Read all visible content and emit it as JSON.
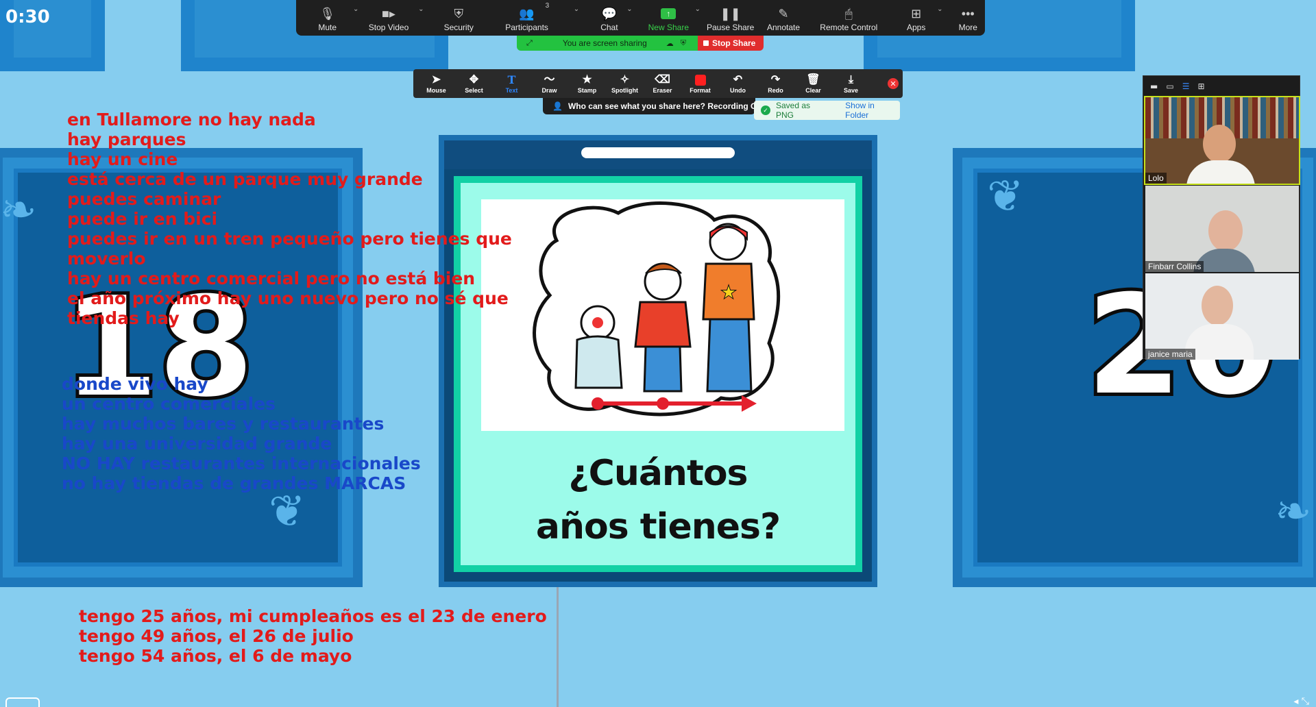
{
  "timer": "0:30",
  "toolbar": {
    "items": [
      {
        "label": "Mute",
        "icon": "microphone-icon"
      },
      {
        "label": "Stop Video",
        "icon": "video-camera-icon"
      },
      {
        "label": "Security",
        "icon": "shield-icon"
      },
      {
        "label": "Participants",
        "icon": "participants-icon",
        "count": "3"
      },
      {
        "label": "Chat",
        "icon": "chat-bubble-icon"
      },
      {
        "label": "New Share",
        "icon": "share-arrow-icon"
      },
      {
        "label": "Pause Share",
        "icon": "pause-icon"
      },
      {
        "label": "Annotate",
        "icon": "pen-icon"
      },
      {
        "label": "Remote Control",
        "icon": "mouse-icon"
      },
      {
        "label": "Apps",
        "icon": "apps-icon"
      },
      {
        "label": "More",
        "icon": "more-dots-icon"
      }
    ]
  },
  "sharing": {
    "status": "You are screen sharing",
    "stop_label": "Stop Share"
  },
  "annotation_toolbar": {
    "tools": [
      "Mouse",
      "Select",
      "Text",
      "Draw",
      "Stamp",
      "Spotlight",
      "Eraser",
      "Format",
      "Undo",
      "Redo",
      "Clear",
      "Save"
    ],
    "active": "Text"
  },
  "who_can_see": "Who can see what you share here? Recording O",
  "toast": {
    "message": "Saved as PNG",
    "link": "Show in Folder"
  },
  "slide": {
    "question_line1": "¿Cuántos",
    "question_line2": "años tienes?",
    "left_number": "18",
    "right_number": "20"
  },
  "annotations": {
    "red_block": "en Tullamore no hay nada\nhay parques\nhay un cine\nestá cerca de un parque muy grande\npuedes caminar\npuede ir en bici\npuedes ir en un tren pequeño pero tienes que\nmoverlo\nhay un centro comercial pero no está bien\nel año próximo hay uno nuevo pero no sé que\ntiendas hay",
    "blue_block": "donde vivo hay\nun centro comerciales\nhay muchos bares y restaurantes\nhay una universidad grande\nNO HAY restaurantes internacionales\nno hay tiendas de grandes MARCAS",
    "bottom_block": "tengo 25 años, mi cumpleaños es el 23 de enero\ntengo 49 años, el 26 de julio\ntengo 54 años, el 6 de mayo"
  },
  "participants": [
    {
      "name": "Lolo"
    },
    {
      "name": "Finbarr Collins"
    },
    {
      "name": "janice maria"
    }
  ]
}
